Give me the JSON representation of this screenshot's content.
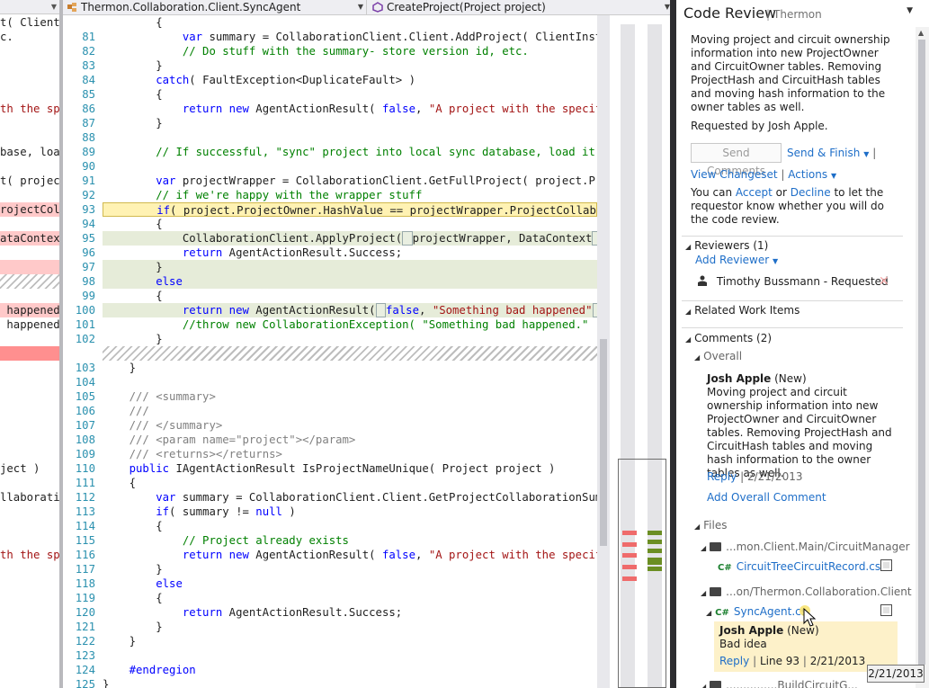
{
  "left_pane": {
    "lines": [
      {
        "text": "t( Client",
        "type": ""
      },
      {
        "text": "c.",
        "type": ""
      },
      {
        "text": "",
        "type": ""
      },
      {
        "text": "",
        "type": ""
      },
      {
        "text": "",
        "type": ""
      },
      {
        "text": "",
        "type": ""
      },
      {
        "text": "th the spe",
        "type": "str"
      },
      {
        "text": "",
        "type": ""
      },
      {
        "text": "",
        "type": ""
      },
      {
        "text": "base, load",
        "type": ""
      },
      {
        "text": "",
        "type": ""
      },
      {
        "text": "t( project",
        "type": ""
      },
      {
        "text": "",
        "type": ""
      },
      {
        "text": "rojectColla",
        "type": "del"
      },
      {
        "text": "",
        "type": ""
      },
      {
        "text": "ataContext",
        "type": "del"
      },
      {
        "text": "",
        "type": ""
      },
      {
        "text": "",
        "type": "del"
      },
      {
        "text": "",
        "type": "hatch"
      },
      {
        "text": "",
        "type": ""
      },
      {
        "text": " happened",
        "type": "del"
      },
      {
        "text": " happened",
        "type": ""
      },
      {
        "text": "",
        "type": ""
      },
      {
        "text": "",
        "type": "solid"
      },
      {
        "text": "",
        "type": ""
      },
      {
        "text": "",
        "type": ""
      },
      {
        "text": "",
        "type": ""
      },
      {
        "text": "",
        "type": ""
      },
      {
        "text": "",
        "type": ""
      },
      {
        "text": "",
        "type": ""
      },
      {
        "text": "",
        "type": ""
      },
      {
        "text": "ject )",
        "type": ""
      },
      {
        "text": "",
        "type": ""
      },
      {
        "text": "llaboratio",
        "type": ""
      },
      {
        "text": "",
        "type": ""
      },
      {
        "text": "",
        "type": ""
      },
      {
        "text": "",
        "type": ""
      },
      {
        "text": "th the spe",
        "type": "str"
      },
      {
        "text": "",
        "type": ""
      },
      {
        "text": "",
        "type": ""
      },
      {
        "text": "",
        "type": ""
      },
      {
        "text": "",
        "type": ""
      },
      {
        "text": "",
        "type": ""
      },
      {
        "text": "",
        "type": ""
      },
      {
        "text": "",
        "type": ""
      },
      {
        "text": "",
        "type": ""
      },
      {
        "text": "",
        "type": ""
      }
    ]
  },
  "nav": {
    "type_dropdown": "Thermon.Collaboration.Client.SyncAgent",
    "member_dropdown": "CreateProject(Project project)"
  },
  "code": {
    "lines": [
      {
        "n": "",
        "type": "",
        "html": "<span>        {</span>"
      },
      {
        "n": "81",
        "type": "",
        "html": "            <span class='kw'>var</span> summary = CollaborationClient.Client.AddProject( ClientInstance"
      },
      {
        "n": "82",
        "type": "",
        "html": "            <span class='cm'>// Do stuff with the summary- store version id, etc.</span>"
      },
      {
        "n": "83",
        "type": "",
        "html": "        }"
      },
      {
        "n": "84",
        "type": "",
        "html": "        <span class='kw'>catch</span>( FaultException&lt;DuplicateFault&gt; )"
      },
      {
        "n": "85",
        "type": "",
        "html": "        {"
      },
      {
        "n": "86",
        "type": "",
        "html": "            <span class='kw'>return</span> <span class='kw'>new</span> AgentActionResult( <span class='kw'>false</span>, <span class='st'>\"A project with the specified</span>"
      },
      {
        "n": "87",
        "type": "",
        "html": "        }"
      },
      {
        "n": "88",
        "type": "",
        "html": ""
      },
      {
        "n": "89",
        "type": "",
        "html": "        <span class='cm'>// If successful, \"sync\" project into local sync database, load it</span>"
      },
      {
        "n": "90",
        "type": "",
        "html": ""
      },
      {
        "n": "91",
        "type": "",
        "html": "        <span class='kw'>var</span> projectWrapper = CollaborationClient.GetFullProject( project.Proj"
      },
      {
        "n": "92",
        "type": "",
        "html": "        <span class='cm'>// if we're happy with the wrapper stuff</span>"
      },
      {
        "n": "93",
        "type": "cur",
        "html": "        <span class='kw'>if</span>( project.ProjectOwner.HashValue == projectWrapper.ProjectCollaborat"
      },
      {
        "n": "94",
        "type": "",
        "html": "        {"
      },
      {
        "n": "95",
        "type": "add",
        "html": "            CollaborationClient.ApplyProject(<span class='hl'> </span>projectWrapper, DataContext<span class='hl'> </span>"
      },
      {
        "n": "96",
        "type": "",
        "html": "            <span class='kw'>return</span> AgentActionResult.Success;"
      },
      {
        "n": "97",
        "type": "add",
        "html": "        }"
      },
      {
        "n": "98",
        "type": "add",
        "html": "        <span class='kw'>else</span>"
      },
      {
        "n": "99",
        "type": "",
        "html": "        {"
      },
      {
        "n": "100",
        "type": "add",
        "html": "            <span class='kw'>return</span> <span class='kw'>new</span> AgentActionResult(<span class='hl'> </span><span class='kw'>false</span>, <span class='st'>\"Something bad happened\"</span><span class='hl'> </span>"
      },
      {
        "n": "101",
        "type": "",
        "html": "            <span class='cm'>//throw new CollaborationException( \"Something bad happened.\" );</span>"
      },
      {
        "n": "102",
        "type": "",
        "html": "        }"
      },
      {
        "n": "",
        "type": "hatch",
        "html": ""
      },
      {
        "n": "103",
        "type": "",
        "html": "    }"
      },
      {
        "n": "104",
        "type": "",
        "html": ""
      },
      {
        "n": "105",
        "type": "",
        "html": "    <span class='xd'>/// &lt;summary&gt;</span>"
      },
      {
        "n": "106",
        "type": "",
        "html": "    <span class='xd'>///</span>"
      },
      {
        "n": "107",
        "type": "",
        "html": "    <span class='xd'>/// &lt;/summary&gt;</span>"
      },
      {
        "n": "108",
        "type": "",
        "html": "    <span class='xd'>/// &lt;param name=\"project\"&gt;&lt;/param&gt;</span>"
      },
      {
        "n": "109",
        "type": "",
        "html": "    <span class='xd'>/// &lt;returns&gt;&lt;/returns&gt;</span>"
      },
      {
        "n": "110",
        "type": "",
        "html": "    <span class='kw'>public</span> IAgentActionResult IsProjectNameUnique( Project project )"
      },
      {
        "n": "111",
        "type": "",
        "html": "    {"
      },
      {
        "n": "112",
        "type": "",
        "html": "        <span class='kw'>var</span> summary = CollaborationClient.Client.GetProjectCollaborationSumm"
      },
      {
        "n": "113",
        "type": "",
        "html": "        <span class='kw'>if</span>( summary != <span class='kw'>null</span> )"
      },
      {
        "n": "114",
        "type": "",
        "html": "        {"
      },
      {
        "n": "115",
        "type": "",
        "html": "            <span class='cm'>// Project already exists</span>"
      },
      {
        "n": "116",
        "type": "",
        "html": "            <span class='kw'>return</span> <span class='kw'>new</span> AgentActionResult( <span class='kw'>false</span>, <span class='st'>\"A project with the specified</span>"
      },
      {
        "n": "117",
        "type": "",
        "html": "        }"
      },
      {
        "n": "118",
        "type": "",
        "html": "        <span class='kw'>else</span>"
      },
      {
        "n": "119",
        "type": "",
        "html": "        {"
      },
      {
        "n": "120",
        "type": "",
        "html": "            <span class='kw'>return</span> AgentActionResult.Success;"
      },
      {
        "n": "121",
        "type": "",
        "html": "        }"
      },
      {
        "n": "122",
        "type": "",
        "html": "    }"
      },
      {
        "n": "123",
        "type": "",
        "html": ""
      },
      {
        "n": "124",
        "type": "",
        "html": "    <span class='kw'>#endregion</span>"
      },
      {
        "n": "125",
        "type": "",
        "html": "}"
      }
    ]
  },
  "overview": {
    "left_color": "#ef6b6b",
    "right_color": "#6b8e23"
  },
  "review": {
    "title": "Code Review",
    "subtitle": "Thermon",
    "description": "Moving project and circuit ownership information into new ProjectOwner and CircuitOwner tables.  Removing ProjectHash and CircuitHash tables and moving hash information to the owner tables as well.",
    "requested_by": "Requested by Josh Apple.",
    "send_comments": "Send Comments",
    "send_finish": "Send & Finish",
    "view_changeset": "View Changeset",
    "actions": "Actions",
    "accept_prefix": "You can",
    "accept": "Accept",
    "or": "or",
    "decline": "Decline",
    "accept_suffix": "to let the requestor know whether you will do the code review.",
    "reviewers_header": "Reviewers (1)",
    "add_reviewer": "Add Reviewer",
    "reviewer_name": "Timothy Bussmann - Requested",
    "related_header": "Related Work Items",
    "comments_header": "Comments (2)",
    "overall": "Overall",
    "overall_comment": {
      "author": "Josh Apple",
      "status": "(New)",
      "body": "Moving project and circuit ownership information into new ProjectOwner and CircuitOwner tables.  Removing ProjectHash and CircuitHash tables and moving hash information to the owner tables as well.",
      "reply": "Reply",
      "date": "2/21/2013"
    },
    "add_overall": "Add Overall Comment",
    "files": "Files",
    "folder1": "...mon.Client.Main/CircuitManager",
    "file1": "CircuitTreeCircuitRecord.cs",
    "folder2": "...on/Thermon.Collaboration.Client",
    "file2": "SyncAgent.cs",
    "file_comment": {
      "author": "Josh Apple",
      "status": "(New)",
      "body": "Bad idea",
      "reply": "Reply",
      "line": "Line 93",
      "date": "2/21/2013"
    },
    "folder3": "...............BuildCircuitG..."
  },
  "tooltip": "2/21/2013"
}
